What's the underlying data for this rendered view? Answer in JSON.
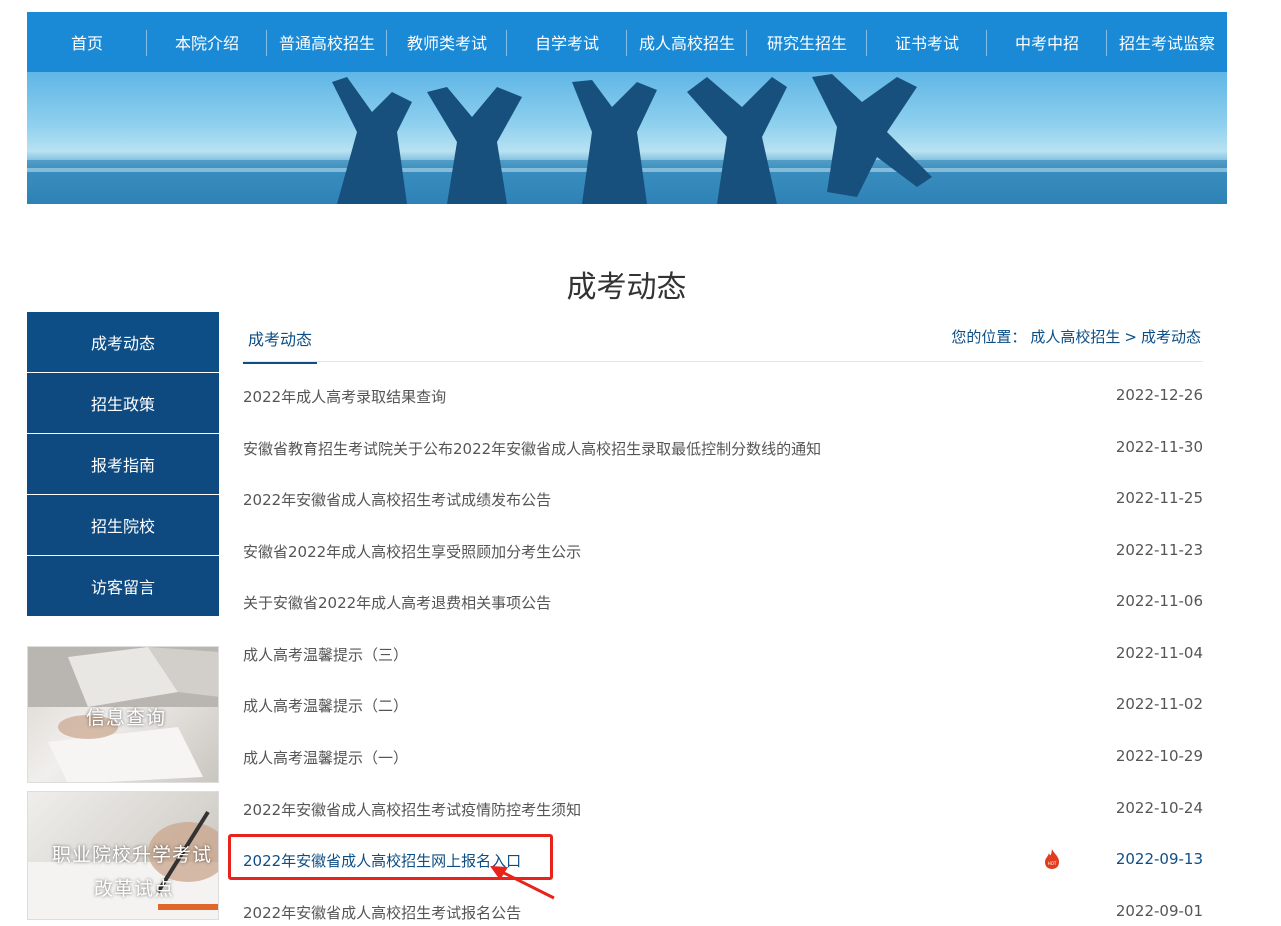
{
  "nav": {
    "items": [
      "首页",
      "本院介绍",
      "普通高校招生",
      "教师类考试",
      "自学考试",
      "成人高校招生",
      "研究生招生",
      "证书考试",
      "中考中招",
      "招生考试监察"
    ]
  },
  "page_title": "成考动态",
  "sidebar": {
    "items": [
      "成考动态",
      "招生政策",
      "报考指南",
      "招生院校",
      "访客留言"
    ]
  },
  "promos": {
    "info_query": "信息查询",
    "vocational_line1": "职业院校升学考试",
    "vocational_line2": "改革试点"
  },
  "content": {
    "tab": "成考动态",
    "breadcrumb": {
      "label": "您的位置：",
      "parent": "成人高校招生",
      "sep": ">",
      "current": "成考动态"
    },
    "news": [
      {
        "title": "2022年成人高考录取结果查询",
        "date": "2022-12-26"
      },
      {
        "title": "安徽省教育招生考试院关于公布2022年安徽省成人高校招生录取最低控制分数线的通知",
        "date": "2022-11-30"
      },
      {
        "title": "2022年安徽省成人高校招生考试成绩发布公告",
        "date": "2022-11-25"
      },
      {
        "title": "安徽省2022年成人高校招生享受照顾加分考生公示",
        "date": "2022-11-23"
      },
      {
        "title": "关于安徽省2022年成人高考退费相关事项公告",
        "date": "2022-11-06"
      },
      {
        "title": "成人高考温馨提示（三）",
        "date": "2022-11-04"
      },
      {
        "title": "成人高考温馨提示（二）",
        "date": "2022-11-02"
      },
      {
        "title": "成人高考温馨提示（一）",
        "date": "2022-10-29"
      },
      {
        "title": "2022年安徽省成人高校招生考试疫情防控考生须知",
        "date": "2022-10-24"
      },
      {
        "title": "2022年安徽省成人高校招生网上报名入口",
        "date": "2022-09-13"
      },
      {
        "title": "2022年安徽省成人高校招生考试报名公告",
        "date": "2022-09-01"
      }
    ],
    "hot_badge": "HOT"
  },
  "colors": {
    "nav_bg": "#1a8ad6",
    "sidebar_bg": "#0e4a80",
    "link_blue": "#0d4e86",
    "highlight_red": "#e8231b"
  }
}
